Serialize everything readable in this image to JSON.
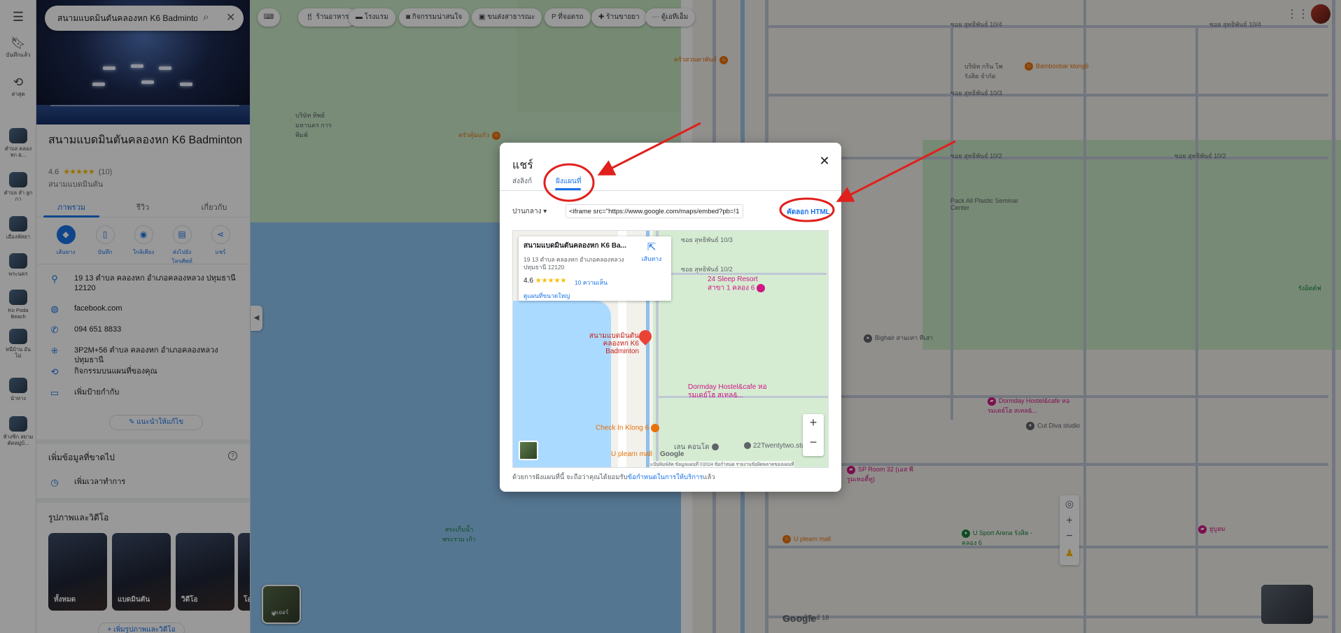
{
  "search": {
    "value": "สนามแบดมินตันคลองหก K6 Badminton"
  },
  "rail": {
    "saved_label": "บันทึกแล้ว",
    "recent_label": "ล่าสุด",
    "recent_items": [
      {
        "label": "ตำบล คลอง หก &..."
      },
      {
        "label": "ตำบล ลำ ลูกกา"
      },
      {
        "label": "เมืองพัทยา"
      },
      {
        "label": "พระนคร"
      },
      {
        "label": "Ko Poda Beach"
      },
      {
        "label": "หนีบ้าน อันไม่"
      },
      {
        "label": "นำทาง"
      },
      {
        "label": "ห้างซิก สยาม ตัดหมู่บ้..."
      }
    ]
  },
  "place": {
    "title": "สนามแบดมินตันคลองหก K6 Badminton",
    "rating": "4.6",
    "stars": "★★★★★",
    "reviews": "(10)",
    "category": "สนามแบดมินตัน",
    "tabs": [
      "ภาพรวม",
      "รีวิว",
      "เกี่ยวกับ"
    ],
    "actions": [
      "เส้นทาง",
      "บันทึก",
      "ใกล้เคียง",
      "ส่งไปยังโทรศัพท์",
      "แชร์"
    ],
    "address": "19 13 ตำบล คลองหก อำเภอคลองหลวง ปทุมธานี 12120",
    "website": "facebook.com",
    "phone": "094 651 8833",
    "plus_code": "3P2M+56 ตำบล คลองหก อำเภอคลองหลวง ปทุมธานี",
    "activity": "กิจกรรมบนแผนที่ของคุณ",
    "add_label": "เพิ่มป้ายกำกับ",
    "suggest_edit": "แนะนำให้แก้ไข",
    "missing_info_title": "เพิ่มข้อมูลที่ขาดไป",
    "add_hours": "เพิ่มเวลาทำการ",
    "photos_title": "รูปภาพและวิดีโอ",
    "photo_tiles": [
      "ทั้งหมด",
      "แบดมินตัน",
      "วิดีโอ",
      "โอ"
    ],
    "add_photos": "เพิ่มรูปภาพและวิดีโอ"
  },
  "chips": [
    "ร้านอาหาร",
    "โรงแรม",
    "กิจกรรมน่าสนใจ",
    "ขนส่งสาธารณะ",
    "ที่จอดรถ",
    "ร้านขายยา",
    "ตู้เอทีเอ็ม"
  ],
  "layers_label": "เลเยอร์",
  "map_labels": {
    "roads": [
      "ซอย สุทธิพันธ์ 10/4",
      "ซอย สุทธิพันธ์ 10/3",
      "ซอย สุทธิพันธ์ 10/2",
      "ซอย สุทธิพันธ์ 10/4",
      "ซอย สุทธิพันธ์ 10/2",
      "ซอย สุทธิพันธ์ 18"
    ],
    "pois": [
      {
        "name": "ครัวสวนตาพันธ์",
        "color": "#e8710a"
      },
      {
        "name": "ครัวคุ้มแก้ว",
        "color": "#e8710a"
      },
      {
        "name": "Bamboobar klong6",
        "color": "#e8710a"
      },
      {
        "name": "Pack All Plastic Seminar Center",
        "color": "#5f6368"
      },
      {
        "name": "Bighair สามเทา ทีเสา",
        "color": "#5f6368"
      },
      {
        "name": "Dormday Hostel&cafe หอรมเดย์โฮ สเทล&...",
        "color": "#d01884"
      },
      {
        "name": "Cut Diva studio",
        "color": "#5f6368"
      },
      {
        "name": "SP Room 32 (เอส พี รูมเทอตี้ทู)",
        "color": "#d01884"
      },
      {
        "name": "U Sport Arena รังสิต - คลอง 6",
        "color": "#188038"
      },
      {
        "name": "U plearn mall",
        "color": "#e8710a"
      },
      {
        "name": "ยูบูฮม",
        "color": "#d01884"
      },
      {
        "name": "รังอิตต์ฟ",
        "color": "#188038"
      },
      {
        "name": "สระเก็บน้ำ พระราม เก้า",
        "color": "#188038"
      },
      {
        "name": "บริษัท ทิพย์ มหานคร การพิมพ์",
        "color": "#5f6368"
      },
      {
        "name": "บริษัท กริน โพ รังสิต จำกัด",
        "color": "#5f6368"
      }
    ],
    "google": "Google"
  },
  "modal": {
    "title": "แชร์",
    "tabs": [
      "ส่งลิงก์",
      "ฝังแผนที่"
    ],
    "size": "ปานกลาง",
    "embed_code": "<iframe src=\"https://www.google.com/maps/embed?pb=!1m14!1m8!",
    "copy_html": "คัดลอก HTML",
    "footer_prefix": "ด้วยการฝังแผนที่นี้ จะถือว่าคุณได้ยอมรับ",
    "footer_link": "ข้อกำหนดในการให้บริการ",
    "footer_suffix": "แล้ว",
    "preview": {
      "card_title": "สนามแบดมินตันคลองหก K6 Ba...",
      "card_address": "19 13 ตำบล คลองหก อำเภอคลองหลวง ปทุมธานี 12120",
      "card_rating": "4.6",
      "card_stars": "★★★★★",
      "card_reviews": "10 ความเห็น",
      "card_directions": "เส้นทาง",
      "card_larger_map": "ดูแผนที่ขนาดใหญ่",
      "pin_label": "สนามแบดมินตัน คลองหก K6 Badminton",
      "road_1": "ซอย สุทธิพันธ์ 10/3",
      "road_2": "ซอย สุทธิพันธ์ 10/2",
      "poi_1": "24 Sleep Resort สาขา 1 คลอง 6",
      "poi_2": "Dormday Hostel&cafe หอรมเดย์โฮ สเทล&...",
      "poi_3": "Check In Klong 6",
      "poi_4": "U plearn mall",
      "poi_5": "เลน คอนโด",
      "poi_6": "22Twentytwo.stu",
      "attribution": "แป้นพิมพ์ลัด   ข้อมูลแผนที่ ©2024   ข้อกำหนด   รายงานข้อผิดพลาดของแผนที่",
      "google": "Google"
    }
  },
  "colors": {
    "accent": "#1a73e8",
    "annotation": "#e0201c",
    "pin": "#ea4335"
  }
}
